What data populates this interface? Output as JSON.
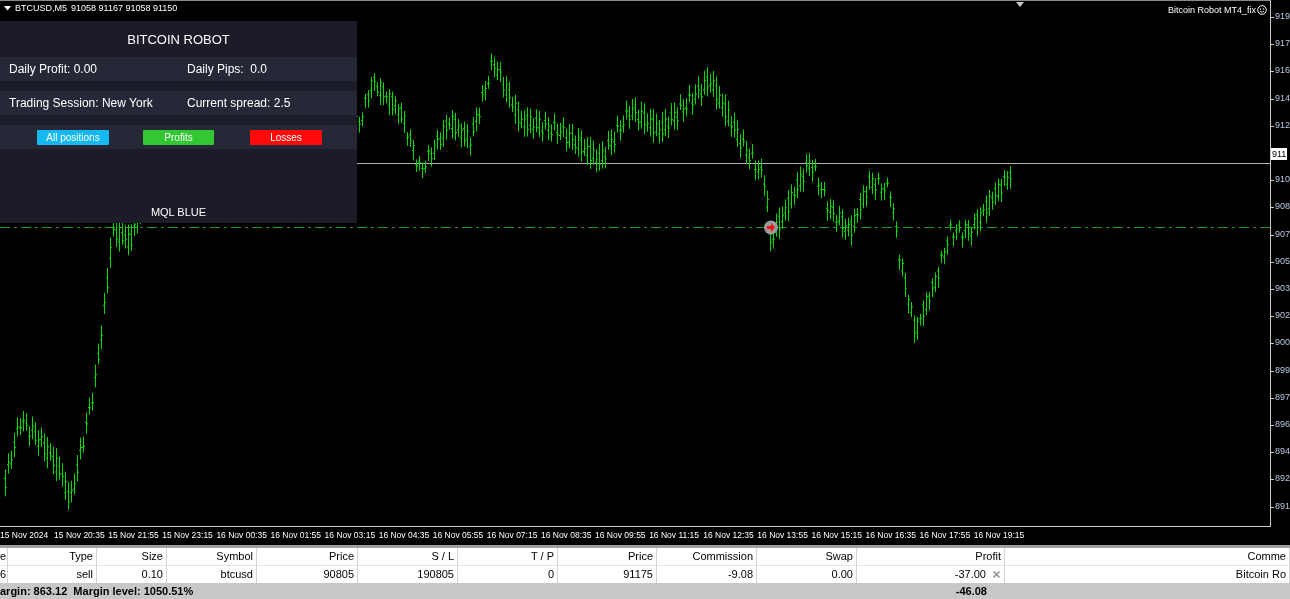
{
  "chart": {
    "symbol": "BTCUSD,M5",
    "ohlc": "91058 91167 91058 91150",
    "expert": "Bitcoin Robot MT4_fix",
    "price_axis": [
      {
        "kind": "tick",
        "label": "919"
      },
      {
        "kind": "tick",
        "label": "917"
      },
      {
        "kind": "tick",
        "label": "916"
      },
      {
        "kind": "tick",
        "label": "914"
      },
      {
        "kind": "tick",
        "label": "912"
      },
      {
        "kind": "current",
        "label": "911"
      },
      {
        "kind": "tick",
        "label": "910"
      },
      {
        "kind": "tick",
        "label": "908"
      },
      {
        "kind": "tick",
        "label": "907"
      },
      {
        "kind": "tick",
        "label": "905"
      },
      {
        "kind": "tick",
        "label": "903"
      },
      {
        "kind": "tick",
        "label": "902"
      },
      {
        "kind": "tick",
        "label": "900"
      },
      {
        "kind": "tick",
        "label": "899"
      },
      {
        "kind": "tick",
        "label": "897"
      },
      {
        "kind": "tick",
        "label": "896"
      },
      {
        "kind": "tick",
        "label": "894"
      },
      {
        "kind": "tick",
        "label": "892"
      },
      {
        "kind": "tick",
        "label": "891"
      }
    ],
    "time_axis": [
      "15 Nov 2024",
      "15 Nov 20:35",
      "15 Nov 21:55",
      "15 Nov 23:15",
      "16 Nov 00:35",
      "16 Nov 01:55",
      "16 Nov 03:15",
      "16 Nov 04:35",
      "16 Nov 05:55",
      "16 Nov 07:15",
      "16 Nov 08:35",
      "16 Nov 09:55",
      "16 Nov 11:15",
      "16 Nov 12:35",
      "16 Nov 13:55",
      "16 Nov 15:15",
      "16 Nov 16:35",
      "16 Nov 17:55",
      "16 Nov 19:15"
    ]
  },
  "panel": {
    "title": "BITCOIN ROBOT",
    "rows": [
      [
        "Daily Profit: 0.00",
        "Daily Pips:  0.0"
      ],
      [
        "Trading Session: New York",
        "Current spread: 2.5"
      ]
    ],
    "buttons": [
      {
        "label": "All positions",
        "color": "#14b9f2"
      },
      {
        "label": "Profits",
        "color": "#32c832"
      },
      {
        "label": "Losses",
        "color": "#ff0a0a"
      }
    ],
    "footer": "MQL BLUE"
  },
  "trades": {
    "columns": [
      "e",
      "Type",
      "Size",
      "Symbol",
      "Price",
      "S / L",
      "T / P",
      "Price",
      "Commission",
      "Swap",
      "Profit",
      "Comme"
    ],
    "rows": [
      [
        "6",
        "sell",
        "0.10",
        "btcusd",
        "90805",
        "190805",
        "0",
        "91175",
        "-9.08",
        "0.00",
        "-37.00",
        "Bitcoin Ro"
      ]
    ],
    "summary": "argin: 863.12  Margin level: 1050.51%",
    "total": "-46.08"
  }
}
